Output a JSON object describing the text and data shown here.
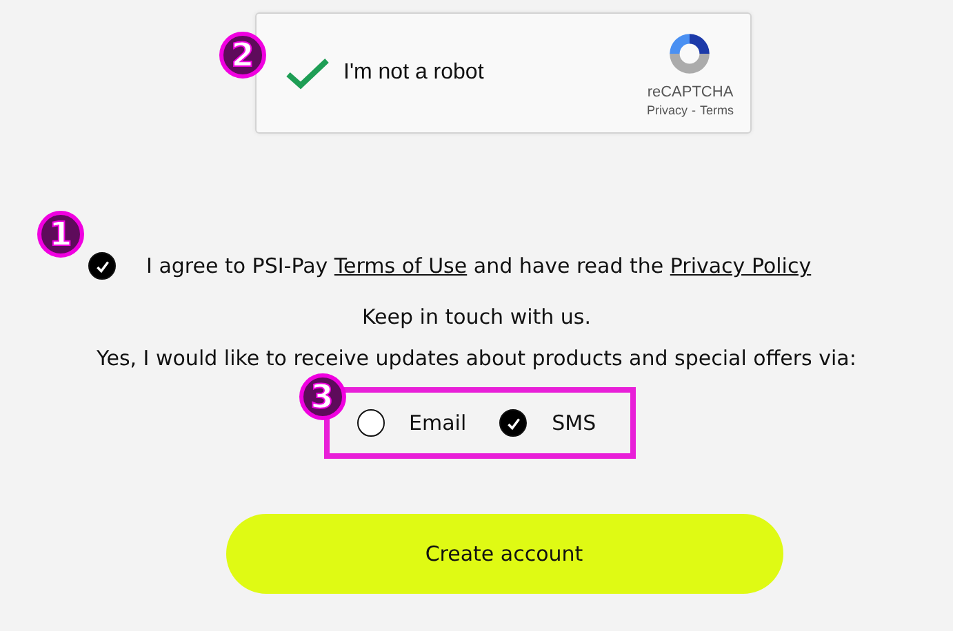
{
  "captcha": {
    "badge": "2",
    "checked": true,
    "label": "I'm not a robot",
    "brand": "reCAPTCHA",
    "privacy": "Privacy",
    "separator": "-",
    "terms": "Terms"
  },
  "consent": {
    "badge": "1",
    "checked": true,
    "parts": [
      {
        "kind": "text",
        "text": "I agree to PSI-Pay "
      },
      {
        "kind": "link",
        "text": "Terms of Use"
      },
      {
        "kind": "text",
        "text": " and have read the "
      },
      {
        "kind": "link",
        "text": "Privacy Policy"
      }
    ]
  },
  "keep_in_touch": "Keep in touch with us.",
  "updates_prompt": "Yes, I would like to receive updates about products and special offers via:",
  "contact_options": {
    "badge": "3",
    "options": [
      {
        "label": "Email",
        "checked": false
      },
      {
        "label": "SMS",
        "checked": true
      }
    ]
  },
  "submit_button": "Create account"
}
